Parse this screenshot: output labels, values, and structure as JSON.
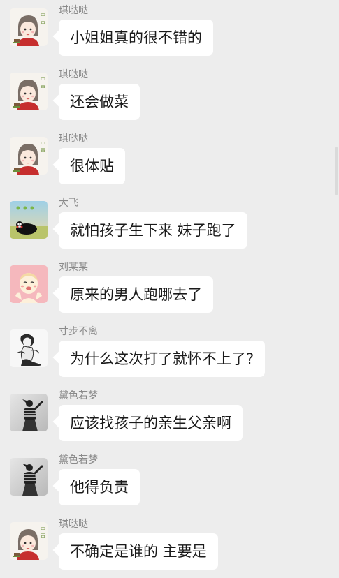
{
  "chat": {
    "messages": [
      {
        "sender": "琪哒哒",
        "avatar_icon": "cartoon-girl-avatar-icon",
        "text": "小姐姐真的很不错的"
      },
      {
        "sender": "琪哒哒",
        "avatar_icon": "cartoon-girl-avatar-icon",
        "text": "还会做菜"
      },
      {
        "sender": "琪哒哒",
        "avatar_icon": "cartoon-girl-avatar-icon",
        "text": "很体贴"
      },
      {
        "sender": "大飞",
        "avatar_icon": "kumamon-avatar-icon",
        "text": "就怕孩子生下来 妹子跑了"
      },
      {
        "sender": "刘某某",
        "avatar_icon": "cartoon-face-avatar-icon",
        "text": "原来的男人跑哪去了"
      },
      {
        "sender": "寸步不离",
        "avatar_icon": "sketch-figure-avatar-icon",
        "text": "为什么这次打了就怀不上了?"
      },
      {
        "sender": "黛色若梦",
        "avatar_icon": "woman-photo-avatar-icon",
        "text": "应该找孩子的亲生父亲啊"
      },
      {
        "sender": "黛色若梦",
        "avatar_icon": "woman-photo-avatar-icon",
        "text": "他得负责"
      },
      {
        "sender": "琪哒哒",
        "avatar_icon": "cartoon-girl-avatar-icon",
        "text": "不确定是谁的 主要是"
      }
    ]
  },
  "colors": {
    "background": "#ededed",
    "bubble": "#ffffff",
    "name_text": "#8a8a8a",
    "message_text": "#1a1a1a"
  }
}
